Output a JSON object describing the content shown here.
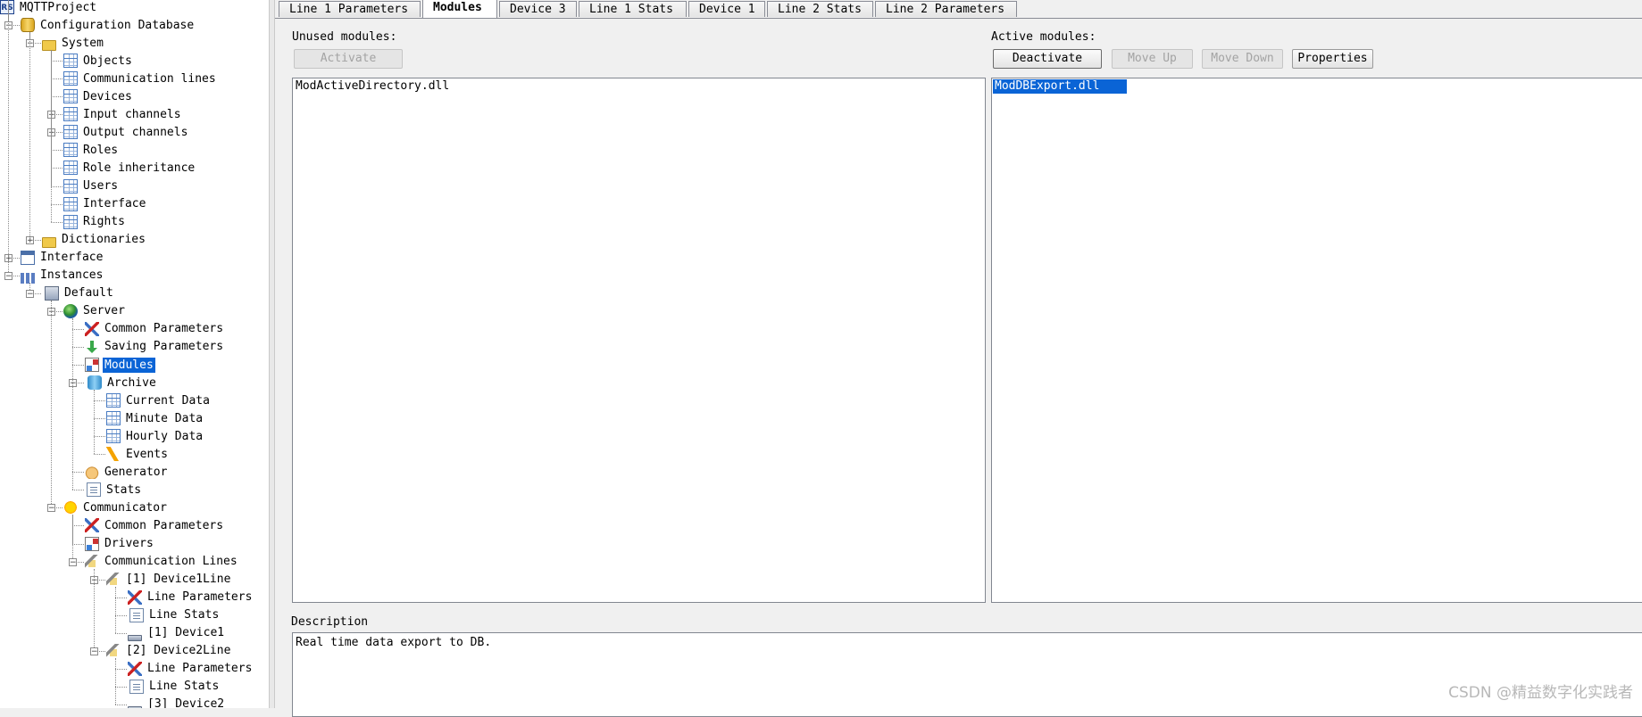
{
  "tree": {
    "nodes": [
      {
        "label": "MQTTProject",
        "icon": "rs-icon",
        "iconText": "RS"
      },
      {
        "label": "Configuration Database",
        "icon": "database-icon",
        "toggle": "-"
      },
      {
        "label": "System",
        "icon": "folder-icon",
        "toggle": "-"
      },
      {
        "label": "Objects",
        "icon": "table-icon"
      },
      {
        "label": "Communication lines",
        "icon": "table-icon"
      },
      {
        "label": "Devices",
        "icon": "table-icon"
      },
      {
        "label": "Input channels",
        "icon": "table-icon",
        "toggle": "+"
      },
      {
        "label": "Output channels",
        "icon": "table-icon",
        "toggle": "+"
      },
      {
        "label": "Roles",
        "icon": "table-icon"
      },
      {
        "label": "Role inheritance",
        "icon": "table-icon"
      },
      {
        "label": "Users",
        "icon": "table-icon"
      },
      {
        "label": "Interface",
        "icon": "table-icon"
      },
      {
        "label": "Rights",
        "icon": "table-icon"
      },
      {
        "label": "Dictionaries",
        "icon": "folder-icon",
        "toggle": "+"
      },
      {
        "label": "Interface",
        "icon": "interface-icon",
        "toggle": "+"
      },
      {
        "label": "Instances",
        "icon": "instances-icon",
        "toggle": "-"
      },
      {
        "label": "Default",
        "icon": "server-icon",
        "toggle": "-"
      },
      {
        "label": "Server",
        "icon": "globe-icon",
        "toggle": "-"
      },
      {
        "label": "Common Parameters",
        "icon": "tools-icon"
      },
      {
        "label": "Saving Parameters",
        "icon": "save-arrow-icon"
      },
      {
        "label": "Modules",
        "icon": "modules-icon",
        "selected": true
      },
      {
        "label": "Archive",
        "icon": "archive-icon",
        "toggle": "-"
      },
      {
        "label": "Current Data",
        "icon": "table-icon"
      },
      {
        "label": "Minute Data",
        "icon": "table-icon"
      },
      {
        "label": "Hourly Data",
        "icon": "table-icon"
      },
      {
        "label": "Events",
        "icon": "bolt-icon"
      },
      {
        "label": "Generator",
        "icon": "hand-icon"
      },
      {
        "label": "Stats",
        "icon": "document-icon"
      },
      {
        "label": "Communicator",
        "icon": "sun-icon",
        "toggle": "-"
      },
      {
        "label": "Common Parameters",
        "icon": "tools-icon"
      },
      {
        "label": "Drivers",
        "icon": "modules-icon"
      },
      {
        "label": "Communication Lines",
        "icon": "lines-icon",
        "toggle": "-"
      },
      {
        "label": "[1] Device1Line",
        "icon": "line-icon",
        "toggle": "-"
      },
      {
        "label": "Line Parameters",
        "icon": "tools-icon"
      },
      {
        "label": "Line Stats",
        "icon": "document-icon"
      },
      {
        "label": "[1] Device1",
        "icon": "device-icon"
      },
      {
        "label": "[2] Device2Line",
        "icon": "line-icon",
        "toggle": "-"
      },
      {
        "label": "Line Parameters",
        "icon": "tools-icon"
      },
      {
        "label": "Line Stats",
        "icon": "document-icon"
      },
      {
        "label": "[3] Device2",
        "icon": "device-icon"
      }
    ]
  },
  "tabs": [
    "Line 1 Parameters",
    "Modules",
    "Device 3",
    "Line 1 Stats",
    "Device 1",
    "Line 2 Stats",
    "Line 2 Parameters"
  ],
  "active_tab": "Modules",
  "unused": {
    "label": "Unused modules:",
    "activate_button": "Activate",
    "items": [
      "ModActiveDirectory.dll"
    ]
  },
  "active": {
    "label": "Active modules:",
    "deactivate_button": "Deactivate",
    "move_up_button": "Move Up",
    "move_down_button": "Move Down",
    "properties_button": "Properties",
    "items": [
      "ModDBExport.dll"
    ],
    "selected_item": "ModDBExport.dll"
  },
  "description": {
    "label": "Description",
    "text": "Real time data export to DB."
  },
  "watermark": "CSDN @精益数字化实践者",
  "colors": {
    "selection": "#0a64d6",
    "background": "#f0f0f0"
  }
}
